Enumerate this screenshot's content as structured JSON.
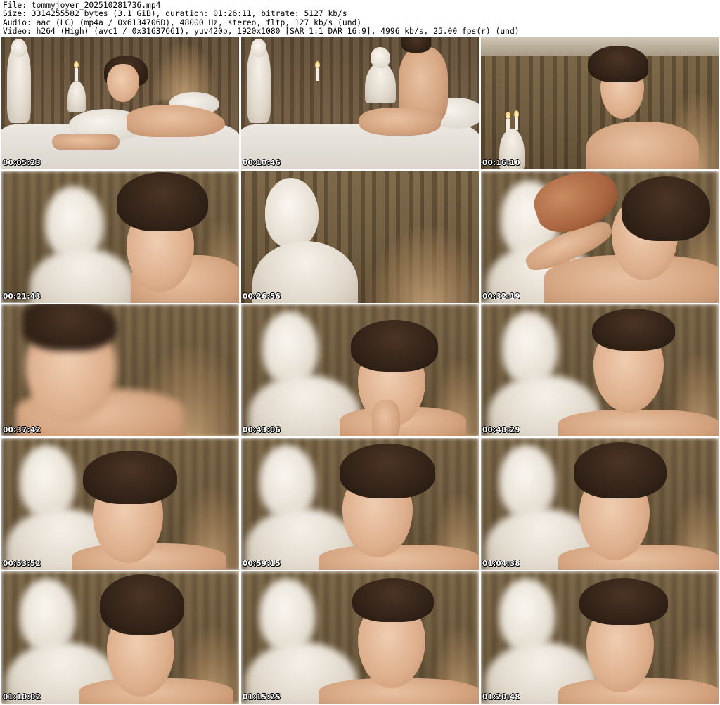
{
  "header": {
    "file": "File: tommyjoyer_202510281736.mp4",
    "size": "Size: 3314255582 bytes (3.1 GiB), duration: 01:26:11, bitrate: 5127 kb/s",
    "audio": "Audio: aac (LC) (mp4a / 0x6134706D), 48000 Hz, stereo, fltp, 127 kb/s (und)",
    "video": "Video: h264 (High) (avc1 / 0x31637661), yuv420p, 1920x1080 [SAR 1:1 DAR 16:9], 4996 kb/s, 25.00 fps(r) (und)"
  },
  "thumbnails": [
    {
      "timestamp": "00:05:23"
    },
    {
      "timestamp": "00:10:46"
    },
    {
      "timestamp": "00:16:10"
    },
    {
      "timestamp": "00:21:43"
    },
    {
      "timestamp": "00:26:56"
    },
    {
      "timestamp": "00:32:19"
    },
    {
      "timestamp": "00:37:42"
    },
    {
      "timestamp": "00:43:06"
    },
    {
      "timestamp": "00:48:29"
    },
    {
      "timestamp": "00:53:52"
    },
    {
      "timestamp": "00:59:15"
    },
    {
      "timestamp": "01:04:38"
    },
    {
      "timestamp": "01:10:02"
    },
    {
      "timestamp": "01:15:25"
    },
    {
      "timestamp": "01:20:48"
    }
  ]
}
